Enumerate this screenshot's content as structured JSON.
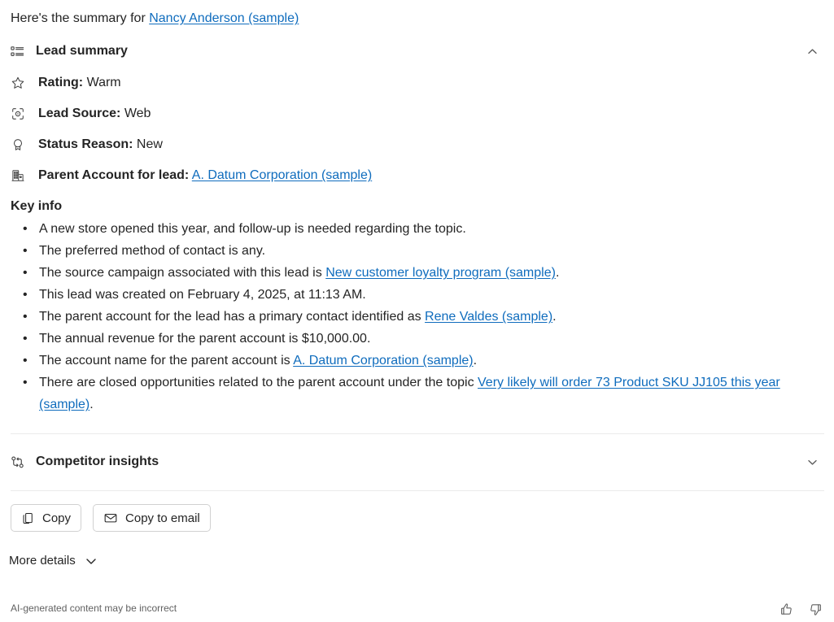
{
  "intro": {
    "prefix": "Here's the summary for ",
    "lead_link": "Nancy Anderson (sample)"
  },
  "lead_summary": {
    "icon": "summary-list-icon",
    "title": "Lead summary",
    "chevron": "chevron-up-icon",
    "fields": [
      {
        "icon": "star-icon",
        "label": "Rating:",
        "value": "Warm"
      },
      {
        "icon": "scan-icon",
        "label": "Lead Source:",
        "value": "Web"
      },
      {
        "icon": "ribbon-icon",
        "label": "Status Reason:",
        "value": "New"
      },
      {
        "icon": "building-icon",
        "label": "Parent Account for lead:",
        "value": "",
        "link": "A. Datum Corporation (sample)"
      }
    ]
  },
  "key_info": {
    "title": "Key info",
    "bullets": [
      {
        "parts": [
          {
            "t": "A new store opened this year, and follow-up is needed regarding the topic."
          }
        ]
      },
      {
        "parts": [
          {
            "t": "The preferred method of contact is any."
          }
        ]
      },
      {
        "parts": [
          {
            "t": "The source campaign associated with this lead is "
          },
          {
            "link": "New customer loyalty program (sample)"
          },
          {
            "t": "."
          }
        ]
      },
      {
        "parts": [
          {
            "t": "This lead was created on February 4, 2025, at 11:13 AM."
          }
        ]
      },
      {
        "parts": [
          {
            "t": "The parent account for the lead has a primary contact identified as "
          },
          {
            "link": "Rene Valdes (sample)"
          },
          {
            "t": "."
          }
        ]
      },
      {
        "parts": [
          {
            "t": "The annual revenue for the parent account is $10,000.00."
          }
        ]
      },
      {
        "parts": [
          {
            "t": "The account name for the parent account is "
          },
          {
            "link": "A. Datum Corporation (sample)"
          },
          {
            "t": "."
          }
        ]
      },
      {
        "parts": [
          {
            "t": "There are closed opportunities related to the parent account under the topic "
          },
          {
            "link": "Very likely will order 73 Product SKU JJ105 this year (sample)"
          },
          {
            "t": "."
          }
        ]
      }
    ]
  },
  "competitor_insights": {
    "icon": "branch-compare-icon",
    "title": "Competitor insights",
    "chevron": "chevron-down-icon"
  },
  "actions": {
    "copy": {
      "icon": "copy-icon",
      "label": "Copy"
    },
    "copy_to_email": {
      "icon": "mail-icon",
      "label": "Copy to email"
    }
  },
  "more_details": {
    "label": "More details",
    "chevron": "chevron-down-icon"
  },
  "footer": {
    "disclaimer": "AI-generated content may be incorrect",
    "thumbs_up": "thumbs-up-icon",
    "thumbs_down": "thumbs-down-icon"
  },
  "colors": {
    "link": "#0f6cbd",
    "text": "#242424",
    "muted": "#616161",
    "divider": "#ebebeb",
    "border": "#d1d1d1",
    "background": "#ffffff"
  }
}
